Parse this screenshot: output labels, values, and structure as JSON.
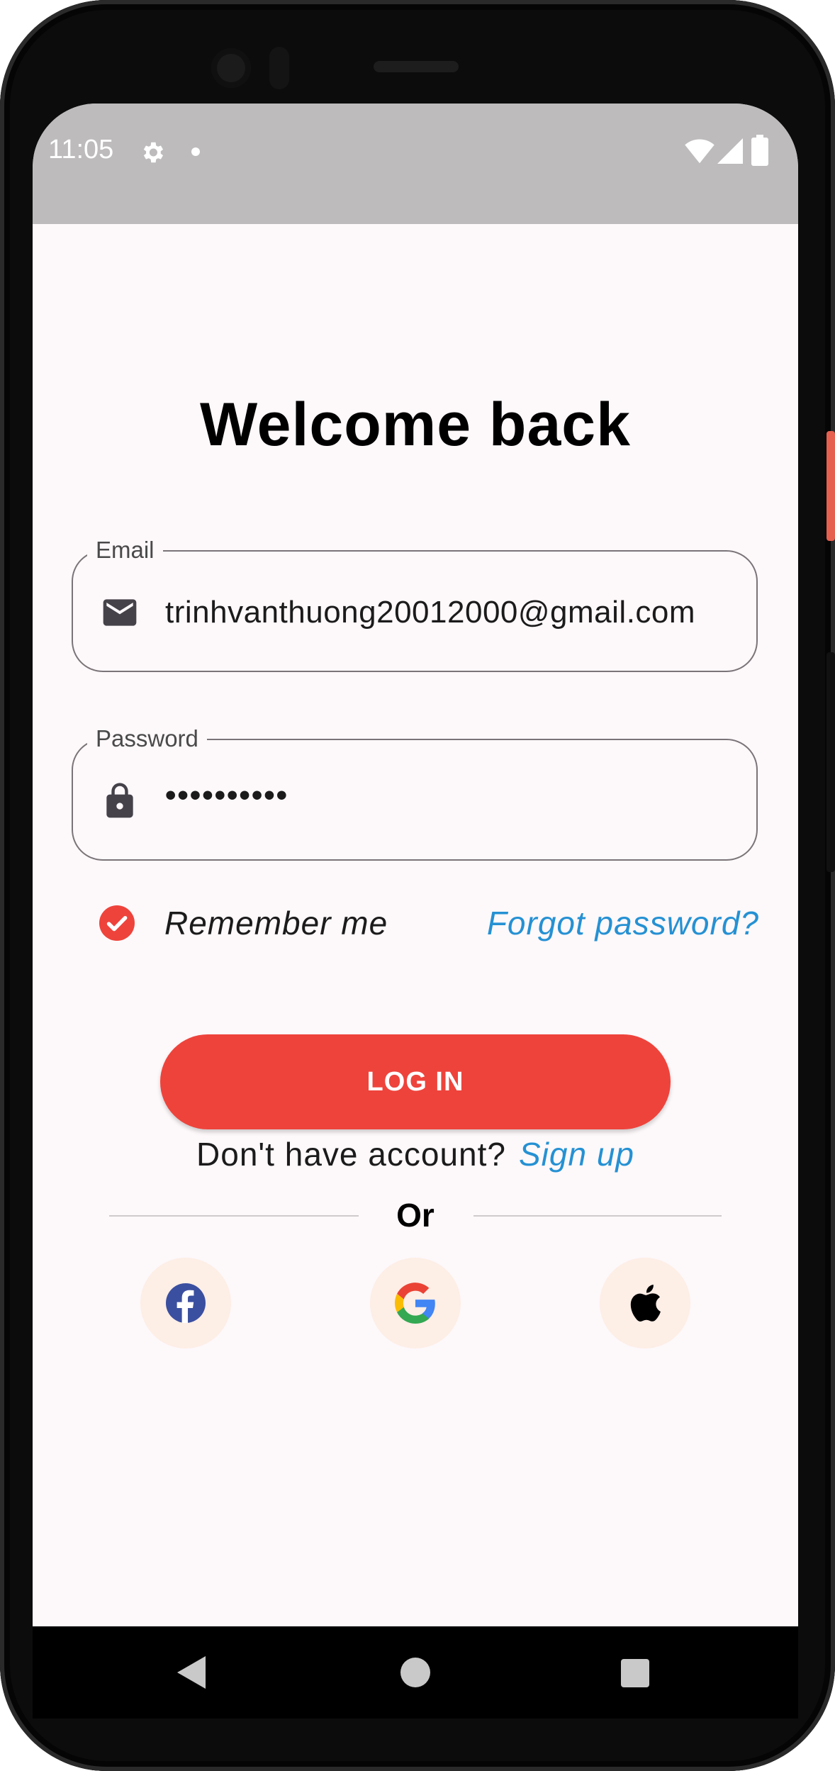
{
  "status_bar": {
    "time": "11:05"
  },
  "login": {
    "title": "Welcome back",
    "email": {
      "label": "Email",
      "value": "trinhvanthuong20012000@gmail.com",
      "icon": "mail-icon"
    },
    "password": {
      "label": "Password",
      "value": "••••••••••",
      "icon": "lock-icon"
    },
    "remember_me": {
      "label": "Remember me",
      "checked": true
    },
    "forgot_password": "Forgot password?",
    "login_button": "LOG IN",
    "no_account_text": "Don't have account?",
    "sign_up_link": "Sign up",
    "divider_text": "Or",
    "social": [
      {
        "name": "facebook",
        "icon": "facebook-icon"
      },
      {
        "name": "google",
        "icon": "google-icon"
      },
      {
        "name": "apple",
        "icon": "apple-icon"
      }
    ]
  },
  "colors": {
    "accent": "#ee433b",
    "link": "#2591d3",
    "background": "#fdf8fa",
    "social_bg": "#fdeee6"
  }
}
